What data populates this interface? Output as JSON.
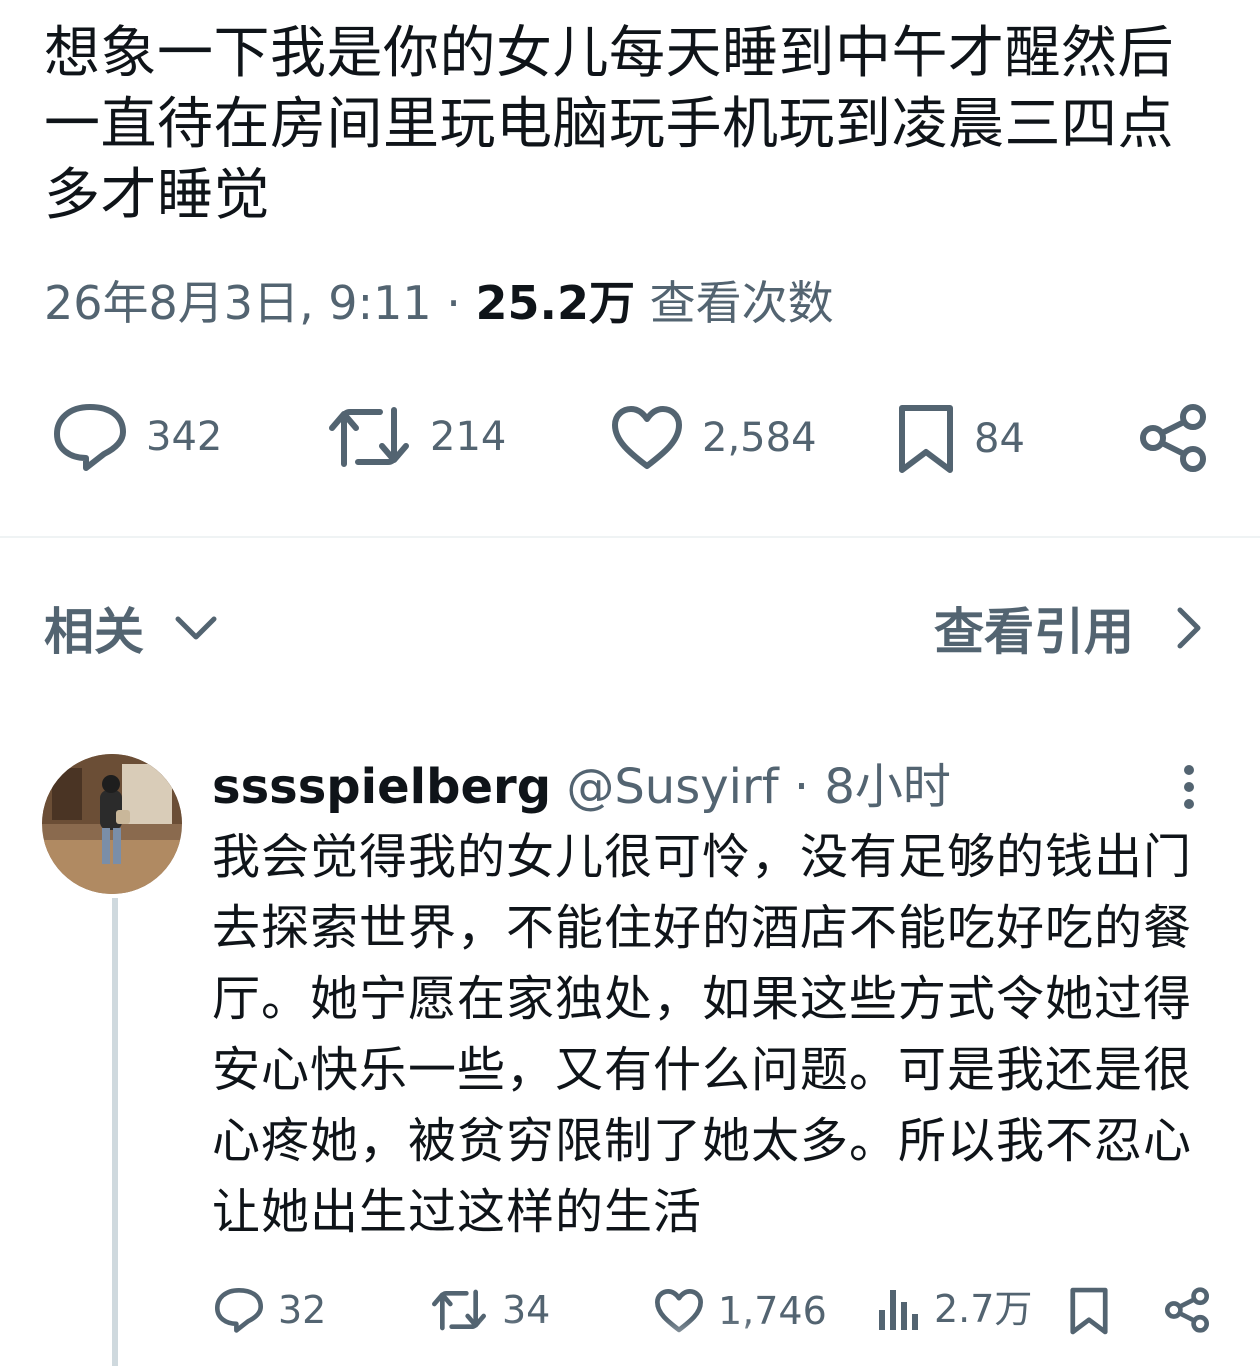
{
  "tweet": {
    "text": "想象一下我是你的女儿每天睡到中午才醒然后一直待在房间里玩电脑玩手机玩到凌晨三四点多才睡觉",
    "date": "26年8月3日, 9:11",
    "separator": "·",
    "views_count": "25.2万",
    "views_label": "查看次数",
    "actions": {
      "replies": "342",
      "retweets": "214",
      "likes": "2,584",
      "bookmarks": "84"
    }
  },
  "related": {
    "label": "相关",
    "quotes_label": "查看引用"
  },
  "reply": {
    "name": "sssspielberg",
    "handle": "@Susyirf",
    "separator": "·",
    "time": "8小时",
    "text": "我会觉得我的女儿很可怜，没有足够的钱出门去探索世界，不能住好的酒店不能吃好吃的餐厅。她宁愿在家独处，如果这些方式令她过得安心快乐一些，又有什么问题。可是我还是很心疼她，被贫穷限制了她太多。所以我不忍心让她出生过这样的生活",
    "actions": {
      "replies": "32",
      "retweets": "34",
      "likes": "1,746",
      "views": "2.7万"
    }
  },
  "colors": {
    "text_primary": "#0f1419",
    "text_secondary": "#536471",
    "divider": "#eff3f4",
    "thread_line": "#cfd9de"
  },
  "icons": [
    "reply-icon",
    "retweet-icon",
    "like-icon",
    "bookmark-icon",
    "share-icon",
    "chevron-down-icon",
    "chevron-right-icon",
    "more-icon",
    "views-icon"
  ]
}
